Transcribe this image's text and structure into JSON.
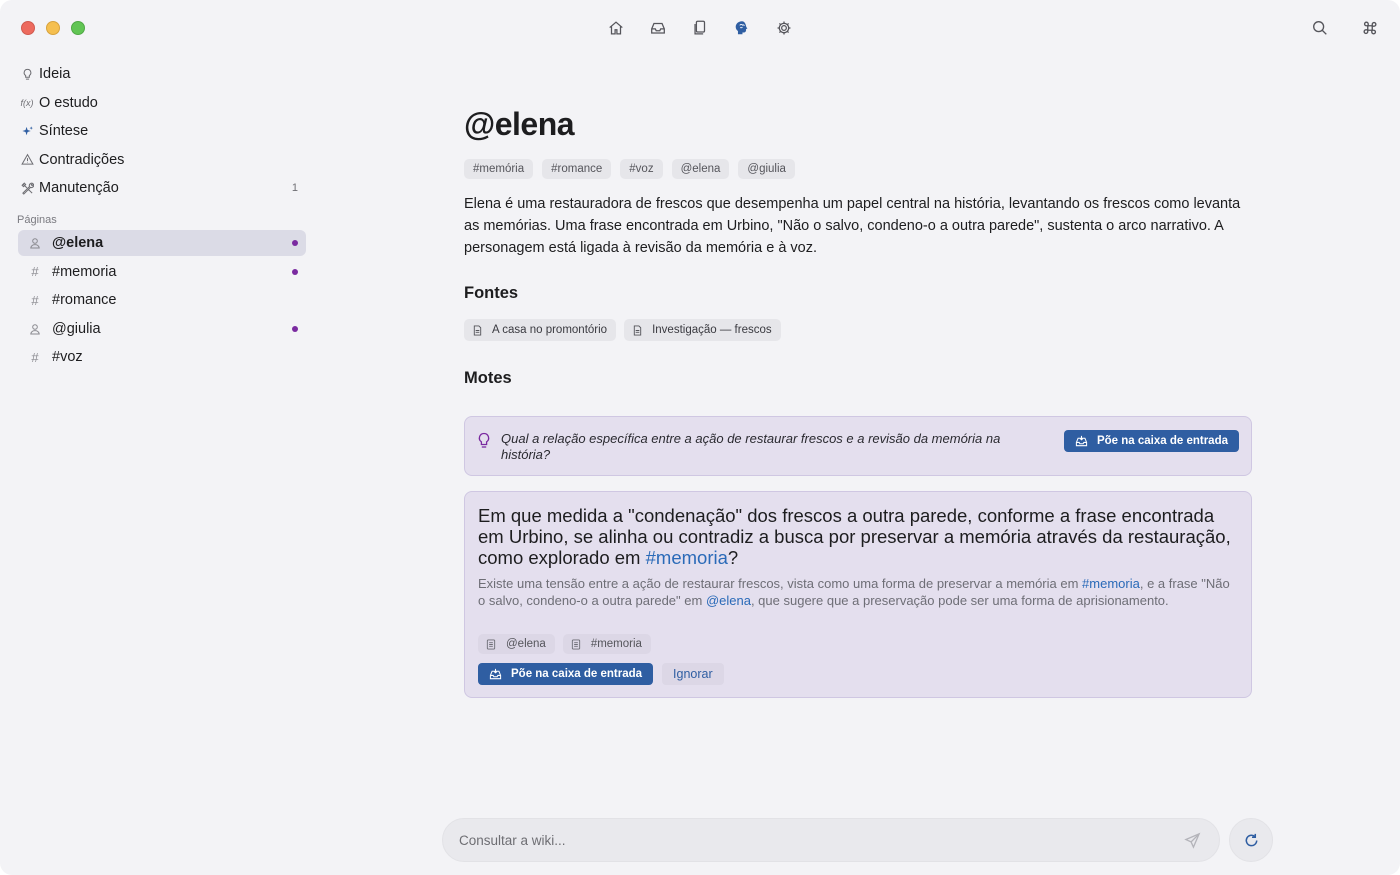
{
  "toolbar": {
    "icons": [
      "home-icon",
      "inbox-icon",
      "documents-icon",
      "brain-icon",
      "gear-icon",
      "search-icon",
      "command-icon"
    ],
    "active_icon": "brain-icon"
  },
  "sidebar": {
    "nav": [
      {
        "label": "Ideia",
        "icon": "lightbulb-icon"
      },
      {
        "label": "O estudo",
        "icon": "function-icon"
      },
      {
        "label": "Síntese",
        "icon": "sparkle-icon"
      },
      {
        "label": "Contradições",
        "icon": "warning-icon"
      },
      {
        "label": "Manutenção",
        "icon": "tools-icon",
        "count": "1"
      }
    ],
    "section_label": "Páginas",
    "pages": [
      {
        "label": "@elena",
        "kind": "person",
        "active": true,
        "dot": true
      },
      {
        "label": "#memoria",
        "kind": "tag",
        "active": false,
        "dot": true
      },
      {
        "label": "#romance",
        "kind": "tag",
        "active": false,
        "dot": false
      },
      {
        "label": "@giulia",
        "kind": "person",
        "active": false,
        "dot": true
      },
      {
        "label": "#voz",
        "kind": "tag",
        "active": false,
        "dot": false
      }
    ]
  },
  "main": {
    "title": "@elena",
    "tags": [
      "#memória",
      "#romance",
      "#voz",
      "@elena",
      "@giulia"
    ],
    "description": "Elena é uma restauradora de frescos que desempenha um papel central na história, levantando os frescos como levanta as memórias. Uma frase encontrada em Urbino, \"Não o salvo, condeno-o a outra parede\", sustenta o arco narrativo. A personagem está ligada à revisão da memória e à voz.",
    "sources_heading": "Fontes",
    "sources": [
      "A casa no promontório",
      "Investigação — frescos"
    ],
    "motes_heading": "Motes",
    "mote1": {
      "question": "Qual a relação específica entre a ação de restaurar frescos e a revisão da memória na história?",
      "button": "Põe na caixa de entrada"
    },
    "mote2": {
      "question_before": "Em que medida a \"condenação\" dos frescos a outra parede, conforme a frase encontrada em Urbino, se alinha ou contradiz a busca por preservar a memória através da restauração, como explorado em ",
      "question_link": "#memoria",
      "question_after": "?",
      "detail_a": "Existe uma tensão entre a ação de restaurar frescos, vista como uma forma de preservar a memória em ",
      "detail_link1": "#memoria",
      "detail_b": ", e a frase \"Não o salvo, condeno-o a outra parede\" em ",
      "detail_link2": "@elena",
      "detail_c": ", que sugere que a preservação pode ser uma forma de aprisionamento.",
      "refs": [
        "@elena",
        "#memoria"
      ],
      "primary_button": "Põe na caixa de entrada",
      "ignore_button": "Ignorar"
    }
  },
  "query": {
    "placeholder": "Consultar a wiki...",
    "value": ""
  },
  "colors": {
    "accent": "#2f5ea2",
    "link": "#2a6ab8",
    "dot": "#7a2aa0",
    "card_bg": "#e4dfee",
    "window_bg": "#f3f3f6"
  }
}
